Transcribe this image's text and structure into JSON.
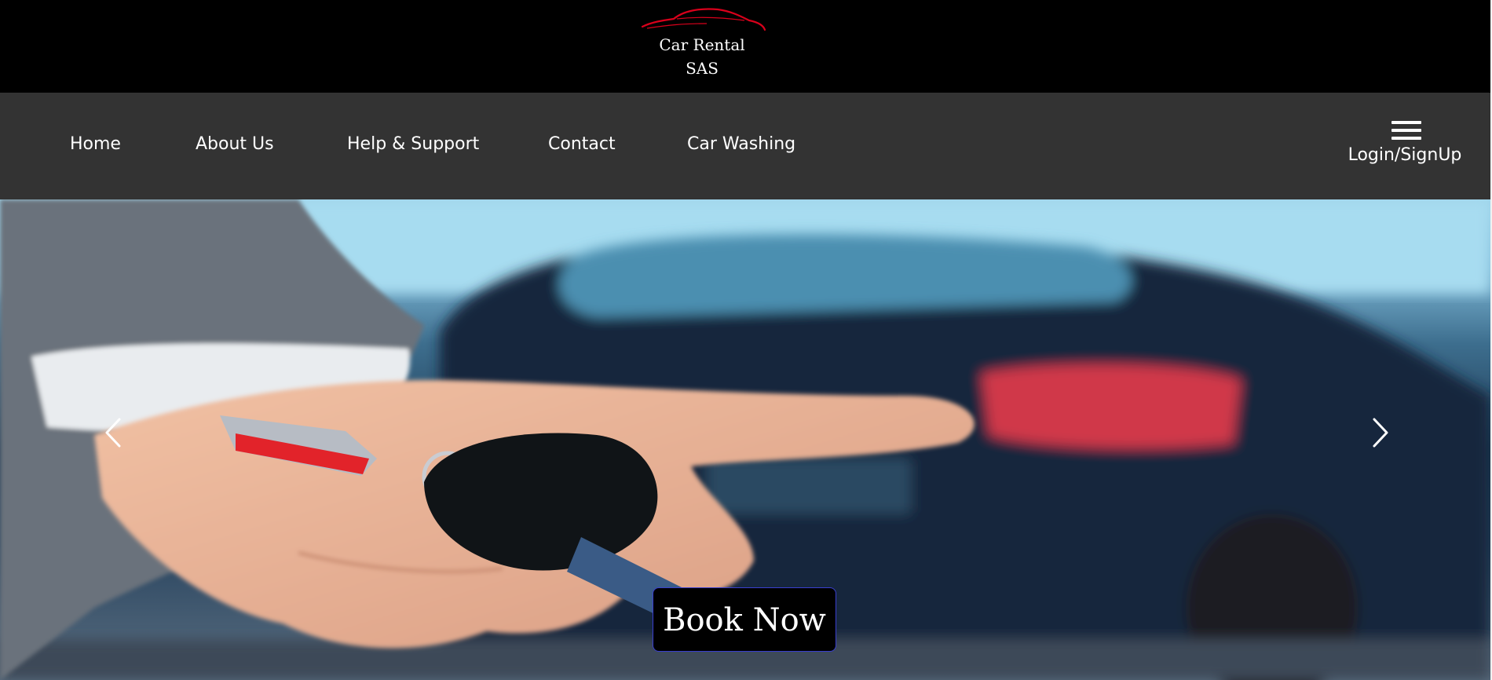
{
  "brand": {
    "line1": "Car Rental",
    "line2": "SAS",
    "logo_icon": "car-silhouette-icon",
    "logo_color": "#d9001b"
  },
  "nav": {
    "links": [
      {
        "label": "Home"
      },
      {
        "label": "About Us"
      },
      {
        "label": "Help & Support"
      },
      {
        "label": "Contact"
      },
      {
        "label": "Car Washing"
      }
    ],
    "menu_icon": "hamburger-icon",
    "login_label": "Login/SignUp"
  },
  "hero": {
    "prev_icon": "chevron-left-icon",
    "next_icon": "chevron-right-icon",
    "cta_label": "Book Now",
    "cta_border_color": "#3a3fcf"
  },
  "colors": {
    "brand_bar": "#000000",
    "navbar": "#333333",
    "text": "#ffffff"
  }
}
